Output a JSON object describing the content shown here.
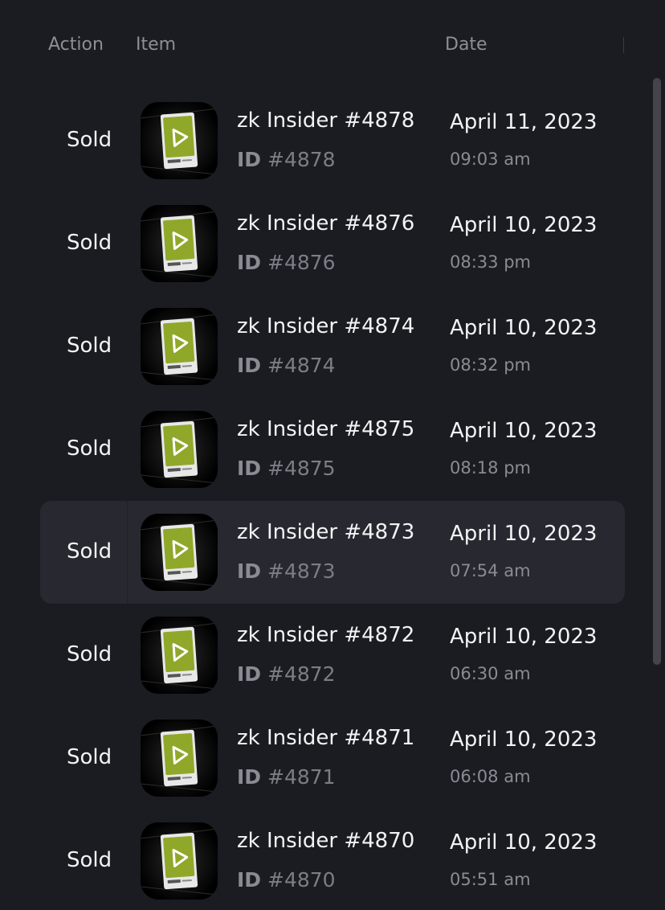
{
  "table": {
    "headers": {
      "action": "Action",
      "item": "Item",
      "date": "Date"
    },
    "rows": [
      {
        "action": "Sold",
        "name": "zk Insider #4878",
        "id_label": "ID",
        "id_value": "#4878",
        "date": "April 11, 2023",
        "time": "09:03 am"
      },
      {
        "action": "Sold",
        "name": "zk Insider #4876",
        "id_label": "ID",
        "id_value": "#4876",
        "date": "April 10, 2023",
        "time": "08:33 pm"
      },
      {
        "action": "Sold",
        "name": "zk Insider #4874",
        "id_label": "ID",
        "id_value": "#4874",
        "date": "April 10, 2023",
        "time": "08:32 pm"
      },
      {
        "action": "Sold",
        "name": "zk Insider #4875",
        "id_label": "ID",
        "id_value": "#4875",
        "date": "April 10, 2023",
        "time": "08:18 pm"
      },
      {
        "action": "Sold",
        "name": "zk Insider #4873",
        "id_label": "ID",
        "id_value": "#4873",
        "date": "April 10, 2023",
        "time": "07:54 am",
        "highlighted": true
      },
      {
        "action": "Sold",
        "name": "zk Insider #4872",
        "id_label": "ID",
        "id_value": "#4872",
        "date": "April 10, 2023",
        "time": "06:30 am"
      },
      {
        "action": "Sold",
        "name": "zk Insider #4871",
        "id_label": "ID",
        "id_value": "#4871",
        "date": "April 10, 2023",
        "time": "06:08 am"
      },
      {
        "action": "Sold",
        "name": "zk Insider #4870",
        "id_label": "ID",
        "id_value": "#4870",
        "date": "April 10, 2023",
        "time": "05:51 am"
      }
    ]
  },
  "thumbnail": {
    "icon": "play-card-icon",
    "card_color": "#8fa82a",
    "play_color": "#ffffff"
  },
  "colors": {
    "background": "#1b1c22",
    "row_highlight": "#272830",
    "text_primary": "#f3f3f5",
    "text_secondary": "#8a8b93"
  }
}
